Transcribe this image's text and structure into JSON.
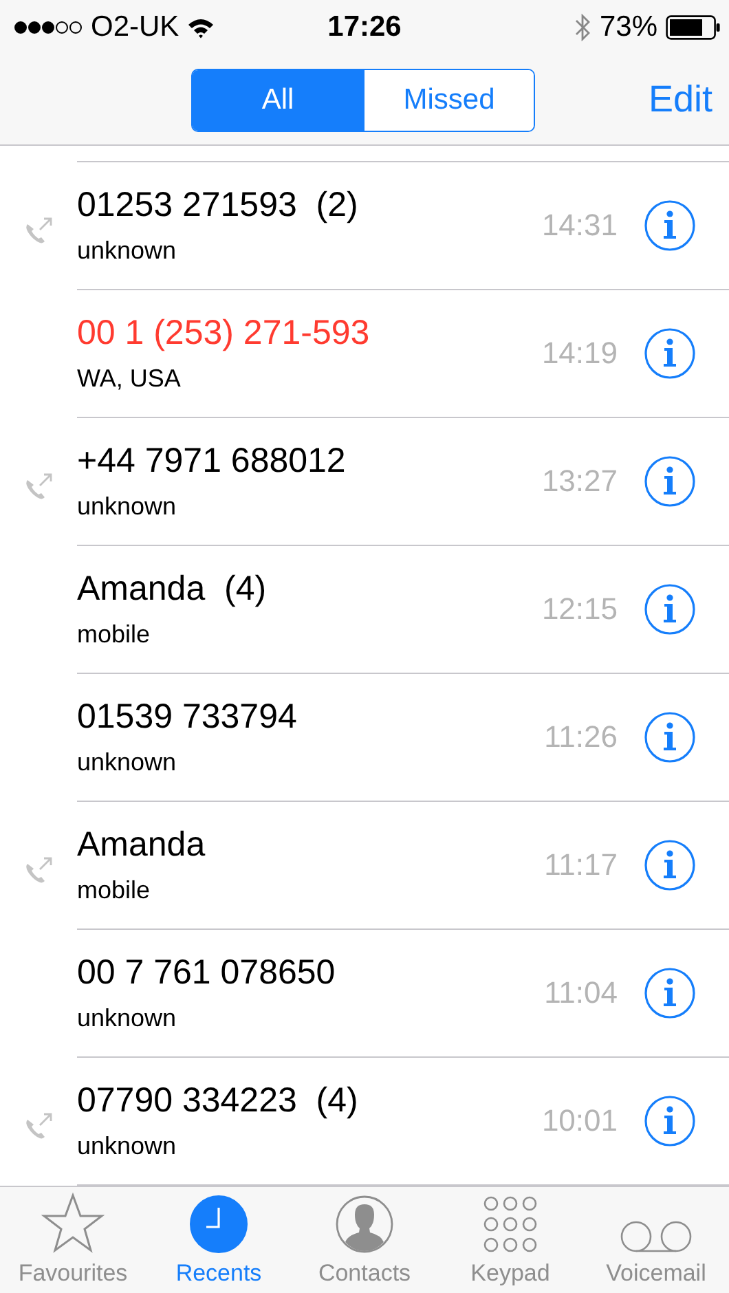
{
  "status_bar": {
    "carrier": "O2-UK",
    "time": "17:26",
    "battery": "73%"
  },
  "segments": [
    {
      "label": "All",
      "selected": true
    },
    {
      "label": "Missed",
      "selected": false
    }
  ],
  "edit_button": "Edit",
  "calls": [
    {
      "number": "01253 271593  (2)",
      "type": "unknown",
      "time": "14:31",
      "outgoing": true,
      "missed": false
    },
    {
      "number": "00 1 (253) 271-593",
      "type": "WA, USA",
      "time": "14:19",
      "outgoing": false,
      "missed": true
    },
    {
      "number": "+44 7971 688012",
      "type": "unknown",
      "time": "13:27",
      "outgoing": true,
      "missed": false
    },
    {
      "number": "Amanda  (4)",
      "type": "mobile",
      "time": "12:15",
      "outgoing": false,
      "missed": false
    },
    {
      "number": "01539 733794",
      "type": "unknown",
      "time": "11:26",
      "outgoing": false,
      "missed": false
    },
    {
      "number": "Amanda",
      "type": "mobile",
      "time": "11:17",
      "outgoing": true,
      "missed": false
    },
    {
      "number": "00 7 761 078650",
      "type": "unknown",
      "time": "11:04",
      "outgoing": false,
      "missed": false
    },
    {
      "number": "07790 334223  (4)",
      "type": "unknown",
      "time": "10:01",
      "outgoing": true,
      "missed": false
    }
  ],
  "tab_bar": [
    {
      "kind": "favourites",
      "label": "Favourites",
      "selected": false
    },
    {
      "kind": "recents",
      "label": "Recents",
      "selected": true
    },
    {
      "kind": "contacts",
      "label": "Contacts",
      "selected": false
    },
    {
      "kind": "keypad",
      "label": "Keypad",
      "selected": false
    },
    {
      "kind": "voicemail",
      "label": "Voicemail",
      "selected": false
    }
  ]
}
